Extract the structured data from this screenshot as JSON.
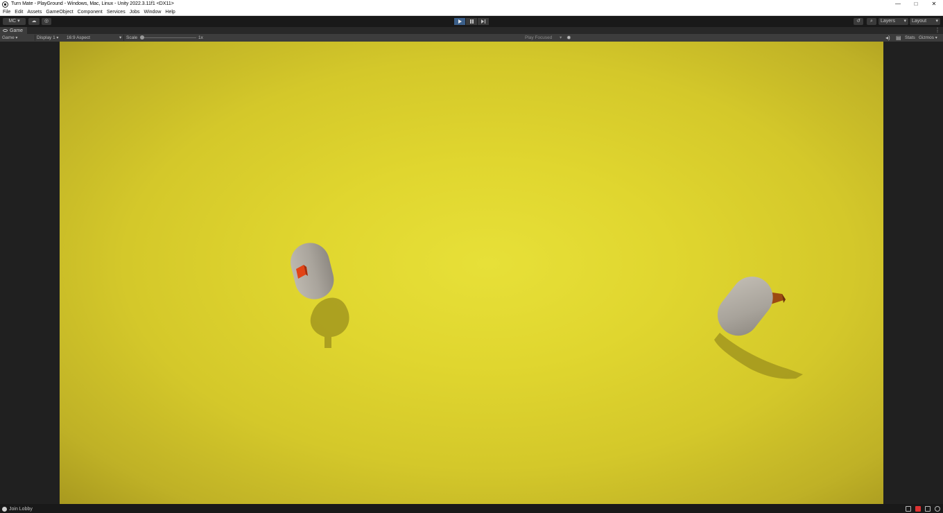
{
  "window": {
    "title": "Turn Mate - PlayGround - Windows, Mac, Linux - Unity 2022.3.11f1 <DX11>",
    "controls": {
      "minimize": "—",
      "maximize": "□",
      "close": "✕"
    }
  },
  "menu": [
    "File",
    "Edit",
    "Assets",
    "GameObject",
    "Component",
    "Services",
    "Jobs",
    "Window",
    "Help"
  ],
  "toolbar": {
    "account_label": "MC",
    "play_state": "playing",
    "layers_label": "Layers",
    "layout_label": "Layout"
  },
  "game_tab": {
    "label": "Game"
  },
  "game_bar": {
    "view_select": "Game",
    "display_select": "Display 1",
    "aspect_select": "16:9 Aspect",
    "scale_label": "Scale",
    "scale_value": "1x",
    "play_mode": "Play Focused",
    "stats_label": "Stats",
    "gizmos_label": "Gizmos"
  },
  "status": {
    "text": "Join Lobby"
  },
  "colors": {
    "ground": "#e2d931",
    "capsule": "#a9a49c",
    "pointer_left": "#e24416",
    "pointer_right": "#9c4a12",
    "play_active": "#3b5f8a"
  }
}
